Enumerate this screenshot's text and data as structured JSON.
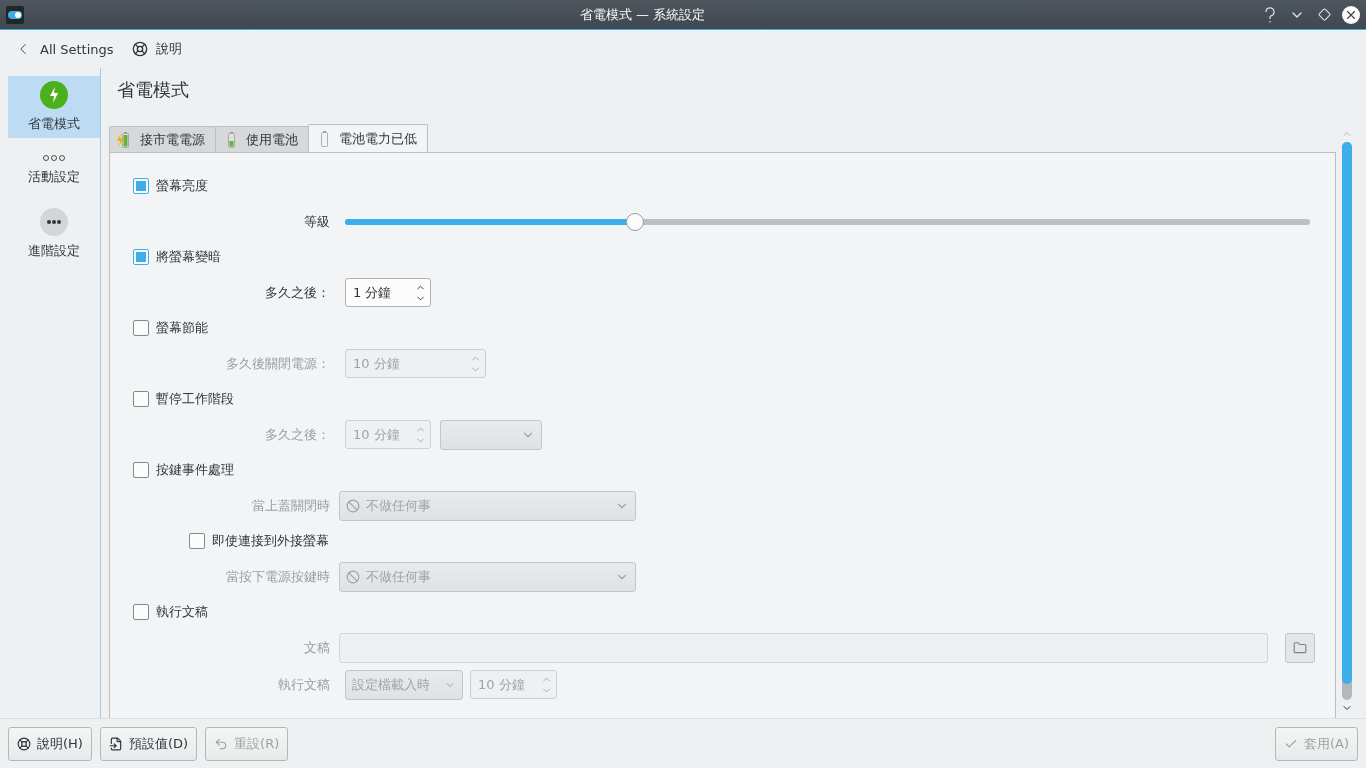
{
  "window": {
    "title": "省電模式 — 系統設定"
  },
  "toolbar": {
    "back": "All Settings",
    "help": "說明"
  },
  "sidebar": {
    "items": [
      {
        "label": "省電模式",
        "kind": "power",
        "selected": true
      },
      {
        "label": "活動設定",
        "kind": "dots",
        "selected": false
      },
      {
        "label": "進階設定",
        "kind": "circle",
        "selected": false
      }
    ]
  },
  "page_title": "省電模式",
  "tabs": [
    {
      "label": "接市電電源",
      "kind": "ac",
      "selected": false
    },
    {
      "label": "使用電池",
      "kind": "battery",
      "selected": false
    },
    {
      "label": "電池電力已低",
      "kind": "low",
      "selected": true
    }
  ],
  "rows": [
    {
      "kind": "checkbox",
      "label": "螢幕亮度",
      "checked": true
    },
    {
      "kind": "slider",
      "label": "等級",
      "level": 0.3
    },
    {
      "kind": "checkbox",
      "label": "將螢幕變暗",
      "checked": true
    },
    {
      "kind": "spin",
      "label": "多久之後：",
      "value": "1 分鐘",
      "disabled": false
    },
    {
      "kind": "checkbox",
      "label": "螢幕節能",
      "checked": false
    },
    {
      "kind": "spin",
      "label": "多久後關閉電源：",
      "value": "10 分鐘",
      "disabled": true
    },
    {
      "kind": "checkbox",
      "label": "暫停工作階段",
      "checked": false
    },
    {
      "kind": "spin_combo",
      "label": "多久之後：",
      "value": "10 分鐘",
      "disabled": true
    },
    {
      "kind": "checkbox",
      "label": "按鍵事件處理",
      "checked": false
    },
    {
      "kind": "combo",
      "label": "當上蓋關閉時",
      "value": "不做任何事",
      "disabled": true
    },
    {
      "kind": "subcheckbox",
      "label": "即使連接到外接螢幕",
      "checked": false
    },
    {
      "kind": "combo",
      "label": "當按下電源按鍵時",
      "value": "不做任何事",
      "disabled": true
    },
    {
      "kind": "checkbox",
      "label": "執行文稿",
      "checked": false
    },
    {
      "kind": "file",
      "label": "文稿",
      "disabled": true
    },
    {
      "kind": "combo_spin",
      "label": "執行文稿",
      "value": "設定檔載入時",
      "value_2": "10 分鐘",
      "disabled": true
    }
  ],
  "buttons": [
    {
      "label": "說明(H)",
      "kind": "help",
      "disabled": false
    },
    {
      "label": "預設值(D)",
      "kind": "defaults",
      "disabled": false
    },
    {
      "label": "重設(R)",
      "kind": "reset",
      "disabled": true
    },
    {
      "label": "套用(A)",
      "kind": "apply",
      "disabled": true
    }
  ]
}
